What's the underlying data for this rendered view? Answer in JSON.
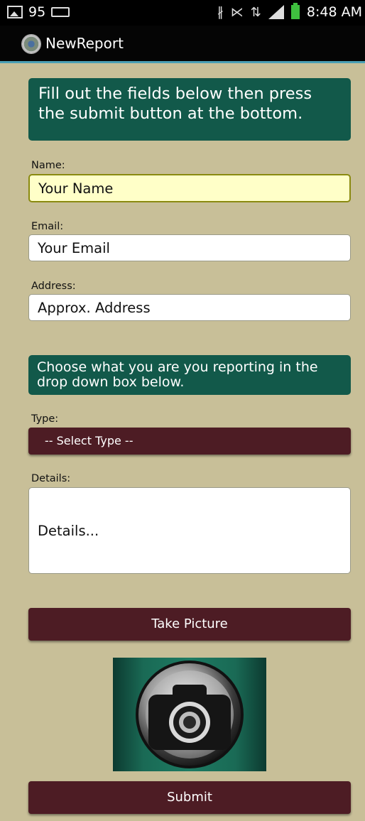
{
  "status_bar": {
    "notification_count": "95",
    "time": "8:48 AM",
    "icons": [
      "image-icon",
      "voicemail-icon",
      "bluetooth-icon",
      "vibrate-off-icon",
      "4g-icon",
      "signal-icon",
      "battery-icon"
    ]
  },
  "action_bar": {
    "title": "NewReport",
    "icon": "app-logo-icon"
  },
  "intro_panel": {
    "text": "Fill out the fields below then press the submit button at the bottom."
  },
  "form": {
    "name": {
      "label": "Name:",
      "value": "Your Name"
    },
    "email": {
      "label": "Email:",
      "value": "Your Email"
    },
    "address": {
      "label": "Address:",
      "value": "Approx. Address"
    },
    "type_panel": {
      "text": "Choose what you are you reporting in the drop down box below."
    },
    "type": {
      "label": "Type:",
      "selected": "-- Select Type --"
    },
    "details": {
      "label": "Details:",
      "value": "Details..."
    }
  },
  "buttons": {
    "take_picture": "Take Picture",
    "submit": "Submit"
  },
  "colors": {
    "background": "#c8bf98",
    "panel": "#12594a",
    "button": "#4d1c24",
    "focused_field": "#ffffc8"
  }
}
